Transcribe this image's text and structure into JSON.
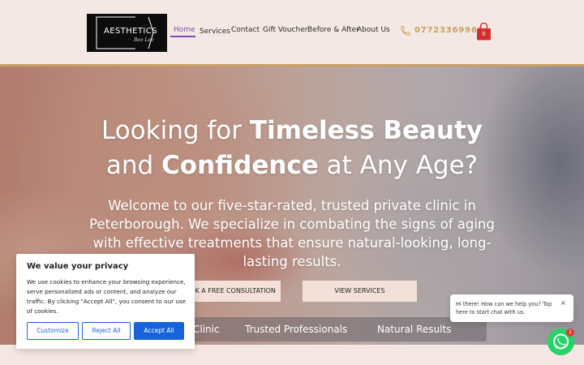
{
  "logo": {
    "text": "AESTHETICS",
    "script": "Bee Lee"
  },
  "nav": {
    "items": [
      {
        "label": "Home",
        "active": true
      },
      {
        "label": "Services"
      },
      {
        "label": "Contact"
      },
      {
        "label": "Gift Voucher"
      },
      {
        "label": "Before & After"
      },
      {
        "label": "About Us"
      }
    ],
    "phone": "07723369966",
    "cart_count": "0"
  },
  "hero": {
    "title_line1_a": "Looking for ",
    "title_line1_b": "Timeless Beauty",
    "title_line2_a": "and ",
    "title_line2_b": "Confidence",
    "title_line2_c": " at Any Age?",
    "subtitle": "Welcome to our five-star-rated, trusted private clinic in Peterborough. We specialize in combating the signs of aging with effective treatments that ensure natural-looking, long-lasting results.",
    "btn_consult": "OK A FREE CONSULTATION",
    "btn_services": "VIEW SERVICES",
    "features": [
      "Clinic",
      "Trusted Professionals",
      "Natural Results"
    ]
  },
  "cookie": {
    "title": "We value your privacy",
    "text": "We use cookies to enhance your browsing experience, serve personalized ads or content, and analyze our traffic. By clicking \"Accept All\", you consent to our use of cookies.",
    "customize": "Customize",
    "reject": "Reject All",
    "accept": "Accept All"
  },
  "chat": {
    "text": "Hi there! How can we help you? Tap here to start chat with us.",
    "close": "×",
    "badge": "1"
  },
  "colors": {
    "accent": "#c9a064",
    "nav_active": "#7b4fb0",
    "cookie_blue": "#1863dc",
    "whatsapp": "#25d366"
  }
}
